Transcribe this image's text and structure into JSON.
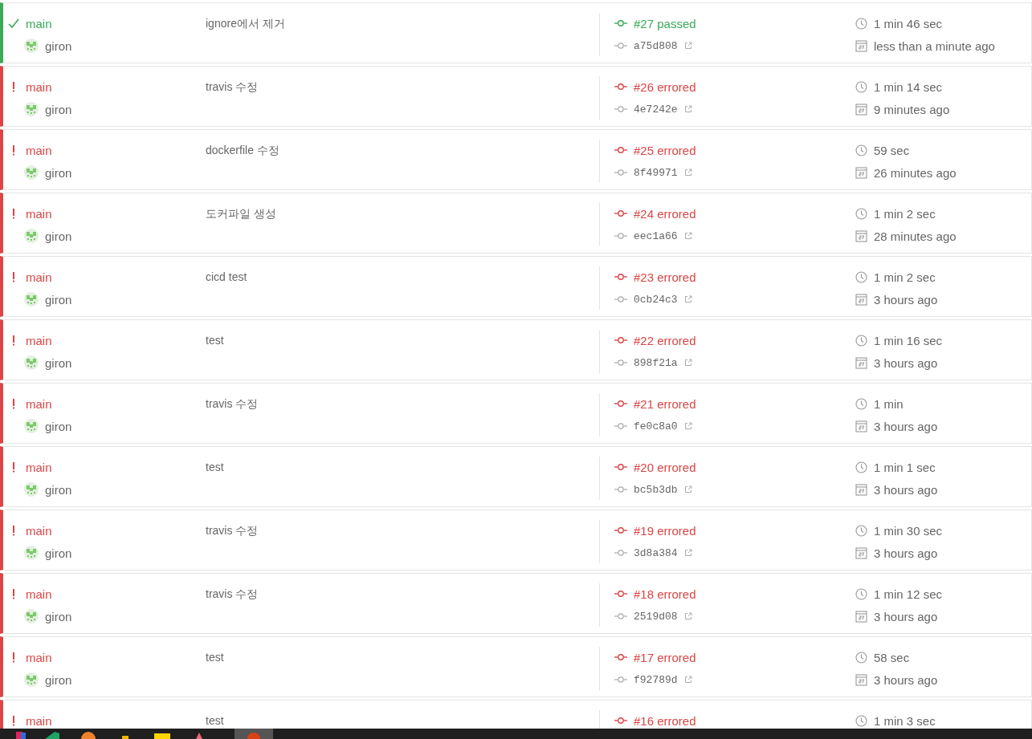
{
  "builds": [
    {
      "kind": "passed",
      "branch": "main",
      "author": "giron",
      "message": "ignore에서 제거",
      "build": "#27 passed",
      "commit": "a75d808",
      "duration": "1 min 46 sec",
      "finished": "less than a minute ago"
    },
    {
      "kind": "errored",
      "branch": "main",
      "author": "giron",
      "message": "travis 수정",
      "build": "#26 errored",
      "commit": "4e7242e",
      "duration": "1 min 14 sec",
      "finished": "9 minutes ago"
    },
    {
      "kind": "errored",
      "branch": "main",
      "author": "giron",
      "message": "dockerfile 수정",
      "build": "#25 errored",
      "commit": "8f49971",
      "duration": "59 sec",
      "finished": "26 minutes ago"
    },
    {
      "kind": "errored",
      "branch": "main",
      "author": "giron",
      "message": "도커파일 생성",
      "build": "#24 errored",
      "commit": "eec1a66",
      "duration": "1 min 2 sec",
      "finished": "28 minutes ago"
    },
    {
      "kind": "errored",
      "branch": "main",
      "author": "giron",
      "message": "cicd test",
      "build": "#23 errored",
      "commit": "0cb24c3",
      "duration": "1 min 2 sec",
      "finished": "3 hours ago"
    },
    {
      "kind": "errored",
      "branch": "main",
      "author": "giron",
      "message": "test",
      "build": "#22 errored",
      "commit": "898f21a",
      "duration": "1 min 16 sec",
      "finished": "3 hours ago"
    },
    {
      "kind": "errored",
      "branch": "main",
      "author": "giron",
      "message": "travis 수정",
      "build": "#21 errored",
      "commit": "fe0c8a0",
      "duration": "1 min",
      "finished": "3 hours ago"
    },
    {
      "kind": "errored",
      "branch": "main",
      "author": "giron",
      "message": "test",
      "build": "#20 errored",
      "commit": "bc5b3db",
      "duration": "1 min 1 sec",
      "finished": "3 hours ago"
    },
    {
      "kind": "errored",
      "branch": "main",
      "author": "giron",
      "message": "travis 수정",
      "build": "#19 errored",
      "commit": "3d8a384",
      "duration": "1 min 30 sec",
      "finished": "3 hours ago"
    },
    {
      "kind": "errored",
      "branch": "main",
      "author": "giron",
      "message": "travis 수정",
      "build": "#18 errored",
      "commit": "2519d08",
      "duration": "1 min 12 sec",
      "finished": "3 hours ago"
    },
    {
      "kind": "errored",
      "branch": "main",
      "author": "giron",
      "message": "test",
      "build": "#17 errored",
      "commit": "f92789d",
      "duration": "58 sec",
      "finished": "3 hours ago"
    },
    {
      "kind": "errored",
      "branch": "main",
      "message": "test",
      "build": "#16 errored",
      "duration": "1 min 3 sec"
    }
  ]
}
